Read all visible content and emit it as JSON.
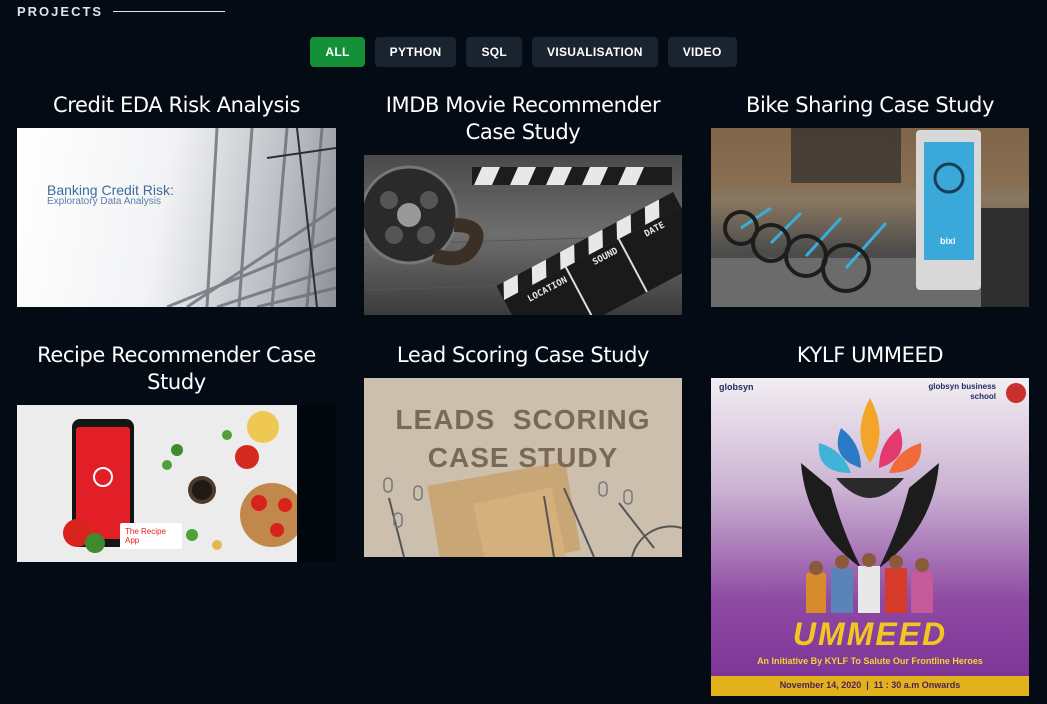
{
  "section": {
    "title": "PROJECTS"
  },
  "filters": [
    {
      "label": "ALL",
      "active": true
    },
    {
      "label": "PYTHON",
      "active": false
    },
    {
      "label": "SQL",
      "active": false
    },
    {
      "label": "VISUALISATION",
      "active": false
    },
    {
      "label": "VIDEO",
      "active": false
    }
  ],
  "projects": [
    {
      "title": "Credit EDA Risk Analysis",
      "thumb_heading": "Banking Credit Risk:",
      "thumb_subheading": "Exploratory Data Analysis"
    },
    {
      "title": "IMDB Movie Recommender Case Study",
      "clapper_words": [
        "LOCATION",
        "SOUND",
        "DATE"
      ]
    },
    {
      "title": "Bike Sharing Case Study",
      "kiosk_text": "bixi"
    },
    {
      "title": "Recipe Recommender Case Study",
      "app_label": "The Recipe App"
    },
    {
      "title": "Lead Scoring Case Study",
      "thumb_line1": "LEADS  SCORING",
      "thumb_line2": "CASE STUDY"
    },
    {
      "title": "KYLF UMMEED",
      "logo_left": "globsyn",
      "logo_right": "globsyn business school",
      "poster_title": "UMMEED",
      "poster_tagline": "An Initiative By KYLF To Salute Our Frontline Heroes",
      "poster_date": "November 14, 2020  |  11 : 30 a.m Onwards"
    }
  ],
  "colors": {
    "background": "#040b14",
    "filter_bg": "#1a2330",
    "filter_active": "#149137"
  }
}
